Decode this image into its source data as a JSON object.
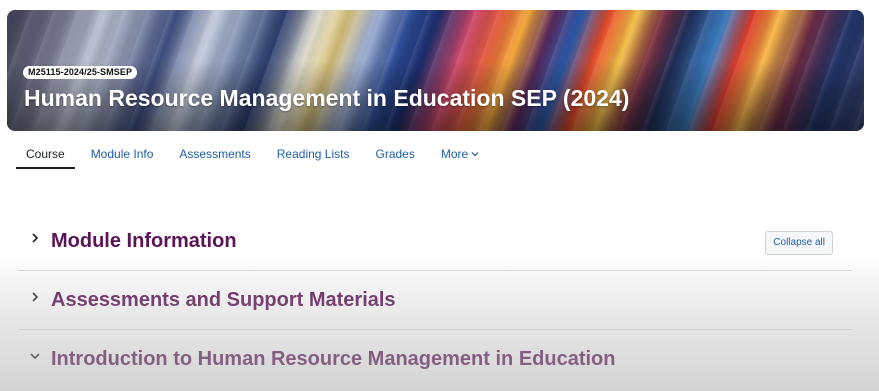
{
  "header": {
    "course_code": "M25115-2024/25-SMSEP",
    "course_title": "Human Resource Management in Education SEP (2024)"
  },
  "nav": {
    "items": [
      {
        "label": "Course",
        "active": true
      },
      {
        "label": "Module Info",
        "active": false
      },
      {
        "label": "Assessments",
        "active": false
      },
      {
        "label": "Reading Lists",
        "active": false
      },
      {
        "label": "Grades",
        "active": false
      },
      {
        "label": "More",
        "active": false,
        "icon": "chevron-down-icon"
      }
    ]
  },
  "sections": [
    {
      "title": "Module Information",
      "expanded": false,
      "icon": "chevron-right-icon"
    },
    {
      "title": "Assessments and Support Materials",
      "expanded": false,
      "icon": "chevron-right-icon"
    },
    {
      "title": "Introduction to Human Resource Management in Education",
      "expanded": true,
      "icon": "chevron-down-icon"
    }
  ],
  "controls": {
    "collapse_all_label": "Collapse all"
  },
  "colors": {
    "section_title": "#5b1456",
    "link": "#1f5ea8",
    "active_tab": "#1d2125"
  }
}
